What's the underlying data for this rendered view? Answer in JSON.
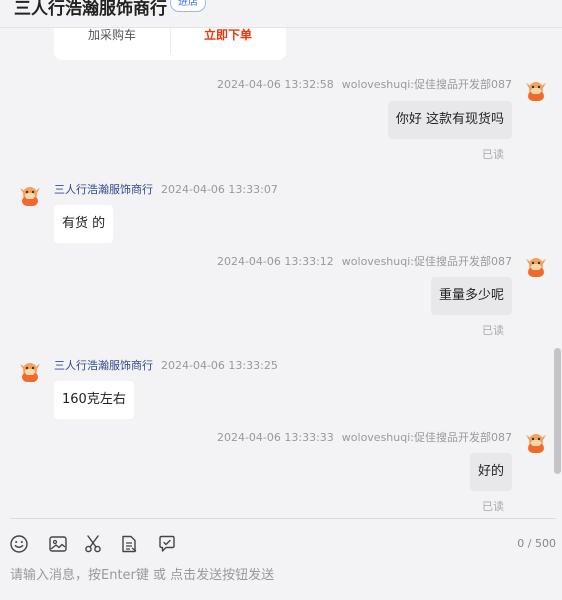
{
  "header": {
    "shop_title": "三人行浩瀚服饰商行",
    "badge": "进店"
  },
  "product_card": {
    "add_cart_label": "加采购车",
    "buy_now_label": "立即下单"
  },
  "messages": [
    {
      "direction": "out",
      "time": "2024-04-06 13:32:58",
      "sender": "woloveshuqi:促佳搜品开发部087",
      "text": "你好 这款有现货吗",
      "status": "已读"
    },
    {
      "direction": "in",
      "sender": "三人行浩瀚服饰商行",
      "time": "2024-04-06 13:33:07",
      "text": "有货 的"
    },
    {
      "direction": "out",
      "time": "2024-04-06 13:33:12",
      "sender": "woloveshuqi:促佳搜品开发部087",
      "text": "重量多少呢",
      "status": "已读"
    },
    {
      "direction": "in",
      "sender": "三人行浩瀚服饰商行",
      "time": "2024-04-06 13:33:25",
      "text": "160克左右"
    },
    {
      "direction": "out",
      "time": "2024-04-06 13:33:33",
      "sender": "woloveshuqi:促佳搜品开发部087",
      "text": "好的",
      "status": "已读"
    }
  ],
  "toolbar": {
    "icons": [
      "emoji-icon",
      "image-icon",
      "scissors-icon",
      "document-icon",
      "quick-reply-icon"
    ],
    "counter": "0 / 500"
  },
  "input": {
    "placeholder": "请输入消息，按Enter键 或 点击发送按钮发送",
    "value": ""
  },
  "colors": {
    "background": "#f3f3f5",
    "outgoing_bubble": "#e8e8eb",
    "incoming_bubble": "#ffffff",
    "shop_name": "#334a8a",
    "buy_now": "#e8380d",
    "avatar": "#f06a2c"
  }
}
